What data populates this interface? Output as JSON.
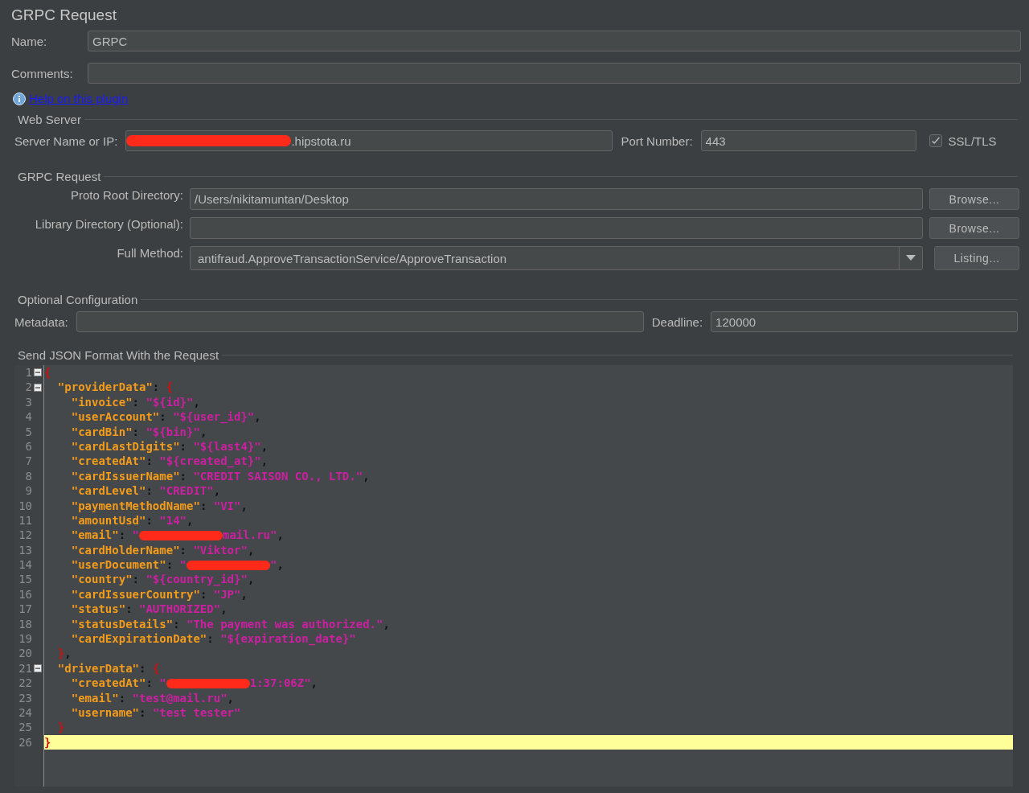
{
  "title": "GRPC Request",
  "name_field": {
    "label": "Name:",
    "value": "GRPC"
  },
  "comments_field": {
    "label": "Comments:"
  },
  "help_link": "Help on this plugin",
  "web_server": {
    "title": "Web Server",
    "server_label": "Server Name or IP:",
    "server_value": [
      {
        "kind": "redaction"
      },
      {
        "kind": "text",
        "text": ".hipstota.ru"
      }
    ],
    "port_label": "Port Number:",
    "port_value": "443",
    "ssl": {
      "label": "SSL/TLS",
      "checked": true
    }
  },
  "grpc_request": {
    "title": "GRPC Request",
    "rows": [
      {
        "kind": "browse",
        "label": "Proto Root Directory:",
        "value": "/Users/nikitamuntan/Desktop",
        "button": "Browse..."
      },
      {
        "kind": "browse",
        "label": "Library Directory (Optional):",
        "button": "Browse..."
      },
      {
        "kind": "combo",
        "label": "Full Method:",
        "value": "antifraud.ApproveTransactionService/ApproveTransaction",
        "button": "Listing..."
      }
    ]
  },
  "optional_configuration": {
    "title": "Optional Configuration",
    "metadata_label": "Metadata:",
    "deadline_label": "Deadline:",
    "deadline_value": "120000"
  },
  "json_editor": {
    "title": "Send JSON Format With the Request",
    "lines": [
      {
        "number": "1",
        "fold": true,
        "current": false,
        "tokens": [
          {
            "kind": "brace",
            "text": "{"
          }
        ]
      },
      {
        "number": "2",
        "fold": true,
        "current": false,
        "tokens": [
          {
            "kind": "key",
            "text": "  \"providerData\""
          },
          {
            "kind": "punct",
            "text": ": "
          },
          {
            "kind": "brace",
            "text": "{"
          }
        ]
      },
      {
        "number": "3",
        "fold": false,
        "current": false,
        "tokens": [
          {
            "kind": "key",
            "text": "    \"invoice\""
          },
          {
            "kind": "punct",
            "text": ": "
          },
          {
            "kind": "string",
            "text": "\"${id}\""
          },
          {
            "kind": "punct",
            "text": ","
          }
        ]
      },
      {
        "number": "4",
        "fold": false,
        "current": false,
        "tokens": [
          {
            "kind": "key",
            "text": "    \"userAccount\""
          },
          {
            "kind": "punct",
            "text": ": "
          },
          {
            "kind": "string",
            "text": "\"${user_id}\""
          },
          {
            "kind": "punct",
            "text": ","
          }
        ]
      },
      {
        "number": "5",
        "fold": false,
        "current": false,
        "tokens": [
          {
            "kind": "key",
            "text": "    \"cardBin\""
          },
          {
            "kind": "punct",
            "text": ": "
          },
          {
            "kind": "string",
            "text": "\"${bin}\""
          },
          {
            "kind": "punct",
            "text": ","
          }
        ]
      },
      {
        "number": "6",
        "fold": false,
        "current": false,
        "tokens": [
          {
            "kind": "key",
            "text": "    \"cardLastDigits\""
          },
          {
            "kind": "punct",
            "text": ": "
          },
          {
            "kind": "string",
            "text": "\"${last4}\""
          },
          {
            "kind": "punct",
            "text": ","
          }
        ]
      },
      {
        "number": "7",
        "fold": false,
        "current": false,
        "tokens": [
          {
            "kind": "key",
            "text": "    \"createdAt\""
          },
          {
            "kind": "punct",
            "text": ": "
          },
          {
            "kind": "string",
            "text": "\"${created_at}\""
          },
          {
            "kind": "punct",
            "text": ","
          }
        ]
      },
      {
        "number": "8",
        "fold": false,
        "current": false,
        "tokens": [
          {
            "kind": "key",
            "text": "    \"cardIssuerName\""
          },
          {
            "kind": "punct",
            "text": ": "
          },
          {
            "kind": "string",
            "text": "\"CREDIT SAISON CO., LTD.\""
          },
          {
            "kind": "punct",
            "text": ","
          }
        ]
      },
      {
        "number": "9",
        "fold": false,
        "current": false,
        "tokens": [
          {
            "kind": "key",
            "text": "    \"cardLevel\""
          },
          {
            "kind": "punct",
            "text": ": "
          },
          {
            "kind": "string",
            "text": "\"CREDIT\""
          },
          {
            "kind": "punct",
            "text": ","
          }
        ]
      },
      {
        "number": "10",
        "fold": false,
        "current": false,
        "tokens": [
          {
            "kind": "key",
            "text": "    \"paymentMethodName\""
          },
          {
            "kind": "punct",
            "text": ": "
          },
          {
            "kind": "string",
            "text": "\"VI\""
          },
          {
            "kind": "punct",
            "text": ","
          }
        ]
      },
      {
        "number": "11",
        "fold": false,
        "current": false,
        "tokens": [
          {
            "kind": "key",
            "text": "    \"amountUsd\""
          },
          {
            "kind": "punct",
            "text": ": "
          },
          {
            "kind": "string",
            "text": "\"14\""
          },
          {
            "kind": "punct",
            "text": ","
          }
        ]
      },
      {
        "number": "12",
        "fold": false,
        "current": false,
        "tokens": [
          {
            "kind": "key",
            "text": "    \"email\""
          },
          {
            "kind": "punct",
            "text": ": "
          },
          {
            "kind": "string",
            "text": "\""
          },
          {
            "kind": "redaction"
          },
          {
            "kind": "string",
            "text": "mail.ru\""
          },
          {
            "kind": "punct",
            "text": ","
          }
        ]
      },
      {
        "number": "13",
        "fold": false,
        "current": false,
        "tokens": [
          {
            "kind": "key",
            "text": "    \"cardHolderName\""
          },
          {
            "kind": "punct",
            "text": ": "
          },
          {
            "kind": "string",
            "text": "\"Viktor\""
          },
          {
            "kind": "punct",
            "text": ","
          }
        ]
      },
      {
        "number": "14",
        "fold": false,
        "current": false,
        "tokens": [
          {
            "kind": "key",
            "text": "    \"userDocument\""
          },
          {
            "kind": "punct",
            "text": ": "
          },
          {
            "kind": "string",
            "text": "\""
          },
          {
            "kind": "redaction"
          },
          {
            "kind": "string",
            "text": "\""
          },
          {
            "kind": "punct",
            "text": ","
          }
        ]
      },
      {
        "number": "15",
        "fold": false,
        "current": false,
        "tokens": [
          {
            "kind": "key",
            "text": "    \"country\""
          },
          {
            "kind": "punct",
            "text": ": "
          },
          {
            "kind": "string",
            "text": "\"${country_id}\""
          },
          {
            "kind": "punct",
            "text": ","
          }
        ]
      },
      {
        "number": "16",
        "fold": false,
        "current": false,
        "tokens": [
          {
            "kind": "key",
            "text": "    \"cardIssuerCountry\""
          },
          {
            "kind": "punct",
            "text": ": "
          },
          {
            "kind": "string",
            "text": "\"JP\""
          },
          {
            "kind": "punct",
            "text": ","
          }
        ]
      },
      {
        "number": "17",
        "fold": false,
        "current": false,
        "tokens": [
          {
            "kind": "key",
            "text": "    \"status\""
          },
          {
            "kind": "punct",
            "text": ": "
          },
          {
            "kind": "string",
            "text": "\"AUTHORIZED\""
          },
          {
            "kind": "punct",
            "text": ","
          }
        ]
      },
      {
        "number": "18",
        "fold": false,
        "current": false,
        "tokens": [
          {
            "kind": "key",
            "text": "    \"statusDetails\""
          },
          {
            "kind": "punct",
            "text": ": "
          },
          {
            "kind": "string",
            "text": "\"The payment was authorized.\""
          },
          {
            "kind": "punct",
            "text": ","
          }
        ]
      },
      {
        "number": "19",
        "fold": false,
        "current": false,
        "tokens": [
          {
            "kind": "key",
            "text": "    \"cardExpirationDate\""
          },
          {
            "kind": "punct",
            "text": ": "
          },
          {
            "kind": "string",
            "text": "\"${expiration_date}\""
          }
        ]
      },
      {
        "number": "20",
        "fold": false,
        "current": false,
        "tokens": [
          {
            "kind": "brace",
            "text": "  }"
          },
          {
            "kind": "punct",
            "text": ","
          }
        ]
      },
      {
        "number": "21",
        "fold": true,
        "current": false,
        "tokens": [
          {
            "kind": "key",
            "text": "  \"driverData\""
          },
          {
            "kind": "punct",
            "text": ": "
          },
          {
            "kind": "brace",
            "text": "{"
          }
        ]
      },
      {
        "number": "22",
        "fold": false,
        "current": false,
        "tokens": [
          {
            "kind": "key",
            "text": "    \"createdAt\""
          },
          {
            "kind": "punct",
            "text": ": "
          },
          {
            "kind": "string",
            "text": "\""
          },
          {
            "kind": "redaction"
          },
          {
            "kind": "string",
            "text": "1:37:06Z\""
          },
          {
            "kind": "punct",
            "text": ","
          }
        ]
      },
      {
        "number": "23",
        "fold": false,
        "current": false,
        "tokens": [
          {
            "kind": "key",
            "text": "    \"email\""
          },
          {
            "kind": "punct",
            "text": ": "
          },
          {
            "kind": "string",
            "text": "\"test@mail.ru\""
          },
          {
            "kind": "punct",
            "text": ","
          }
        ]
      },
      {
        "number": "24",
        "fold": false,
        "current": false,
        "tokens": [
          {
            "kind": "key",
            "text": "    \"username\""
          },
          {
            "kind": "punct",
            "text": ": "
          },
          {
            "kind": "string",
            "text": "\"test tester\""
          }
        ]
      },
      {
        "number": "25",
        "fold": false,
        "current": false,
        "tokens": [
          {
            "kind": "brace",
            "text": "  }"
          }
        ]
      },
      {
        "number": "26",
        "fold": false,
        "current": true,
        "tokens": [
          {
            "kind": "brace",
            "text": "}"
          }
        ]
      }
    ]
  }
}
